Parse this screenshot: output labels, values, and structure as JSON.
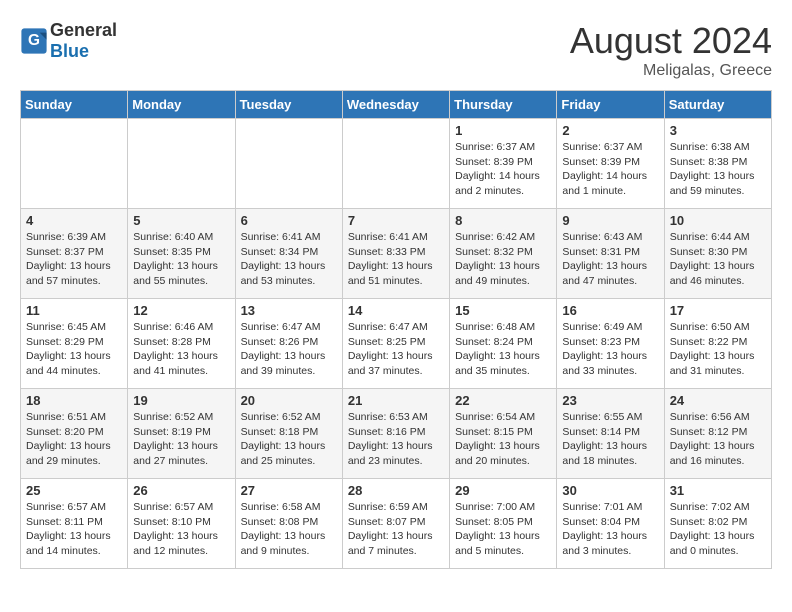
{
  "header": {
    "logo_general": "General",
    "logo_blue": "Blue",
    "month_year": "August 2024",
    "location": "Meligalas, Greece"
  },
  "days_of_week": [
    "Sunday",
    "Monday",
    "Tuesday",
    "Wednesday",
    "Thursday",
    "Friday",
    "Saturday"
  ],
  "weeks": [
    [
      {
        "day": "",
        "detail": ""
      },
      {
        "day": "",
        "detail": ""
      },
      {
        "day": "",
        "detail": ""
      },
      {
        "day": "",
        "detail": ""
      },
      {
        "day": "1",
        "detail": "Sunrise: 6:37 AM\nSunset: 8:39 PM\nDaylight: 14 hours\nand 2 minutes."
      },
      {
        "day": "2",
        "detail": "Sunrise: 6:37 AM\nSunset: 8:39 PM\nDaylight: 14 hours\nand 1 minute."
      },
      {
        "day": "3",
        "detail": "Sunrise: 6:38 AM\nSunset: 8:38 PM\nDaylight: 13 hours\nand 59 minutes."
      }
    ],
    [
      {
        "day": "4",
        "detail": "Sunrise: 6:39 AM\nSunset: 8:37 PM\nDaylight: 13 hours\nand 57 minutes."
      },
      {
        "day": "5",
        "detail": "Sunrise: 6:40 AM\nSunset: 8:35 PM\nDaylight: 13 hours\nand 55 minutes."
      },
      {
        "day": "6",
        "detail": "Sunrise: 6:41 AM\nSunset: 8:34 PM\nDaylight: 13 hours\nand 53 minutes."
      },
      {
        "day": "7",
        "detail": "Sunrise: 6:41 AM\nSunset: 8:33 PM\nDaylight: 13 hours\nand 51 minutes."
      },
      {
        "day": "8",
        "detail": "Sunrise: 6:42 AM\nSunset: 8:32 PM\nDaylight: 13 hours\nand 49 minutes."
      },
      {
        "day": "9",
        "detail": "Sunrise: 6:43 AM\nSunset: 8:31 PM\nDaylight: 13 hours\nand 47 minutes."
      },
      {
        "day": "10",
        "detail": "Sunrise: 6:44 AM\nSunset: 8:30 PM\nDaylight: 13 hours\nand 46 minutes."
      }
    ],
    [
      {
        "day": "11",
        "detail": "Sunrise: 6:45 AM\nSunset: 8:29 PM\nDaylight: 13 hours\nand 44 minutes."
      },
      {
        "day": "12",
        "detail": "Sunrise: 6:46 AM\nSunset: 8:28 PM\nDaylight: 13 hours\nand 41 minutes."
      },
      {
        "day": "13",
        "detail": "Sunrise: 6:47 AM\nSunset: 8:26 PM\nDaylight: 13 hours\nand 39 minutes."
      },
      {
        "day": "14",
        "detail": "Sunrise: 6:47 AM\nSunset: 8:25 PM\nDaylight: 13 hours\nand 37 minutes."
      },
      {
        "day": "15",
        "detail": "Sunrise: 6:48 AM\nSunset: 8:24 PM\nDaylight: 13 hours\nand 35 minutes."
      },
      {
        "day": "16",
        "detail": "Sunrise: 6:49 AM\nSunset: 8:23 PM\nDaylight: 13 hours\nand 33 minutes."
      },
      {
        "day": "17",
        "detail": "Sunrise: 6:50 AM\nSunset: 8:22 PM\nDaylight: 13 hours\nand 31 minutes."
      }
    ],
    [
      {
        "day": "18",
        "detail": "Sunrise: 6:51 AM\nSunset: 8:20 PM\nDaylight: 13 hours\nand 29 minutes."
      },
      {
        "day": "19",
        "detail": "Sunrise: 6:52 AM\nSunset: 8:19 PM\nDaylight: 13 hours\nand 27 minutes."
      },
      {
        "day": "20",
        "detail": "Sunrise: 6:52 AM\nSunset: 8:18 PM\nDaylight: 13 hours\nand 25 minutes."
      },
      {
        "day": "21",
        "detail": "Sunrise: 6:53 AM\nSunset: 8:16 PM\nDaylight: 13 hours\nand 23 minutes."
      },
      {
        "day": "22",
        "detail": "Sunrise: 6:54 AM\nSunset: 8:15 PM\nDaylight: 13 hours\nand 20 minutes."
      },
      {
        "day": "23",
        "detail": "Sunrise: 6:55 AM\nSunset: 8:14 PM\nDaylight: 13 hours\nand 18 minutes."
      },
      {
        "day": "24",
        "detail": "Sunrise: 6:56 AM\nSunset: 8:12 PM\nDaylight: 13 hours\nand 16 minutes."
      }
    ],
    [
      {
        "day": "25",
        "detail": "Sunrise: 6:57 AM\nSunset: 8:11 PM\nDaylight: 13 hours\nand 14 minutes."
      },
      {
        "day": "26",
        "detail": "Sunrise: 6:57 AM\nSunset: 8:10 PM\nDaylight: 13 hours\nand 12 minutes."
      },
      {
        "day": "27",
        "detail": "Sunrise: 6:58 AM\nSunset: 8:08 PM\nDaylight: 13 hours\nand 9 minutes."
      },
      {
        "day": "28",
        "detail": "Sunrise: 6:59 AM\nSunset: 8:07 PM\nDaylight: 13 hours\nand 7 minutes."
      },
      {
        "day": "29",
        "detail": "Sunrise: 7:00 AM\nSunset: 8:05 PM\nDaylight: 13 hours\nand 5 minutes."
      },
      {
        "day": "30",
        "detail": "Sunrise: 7:01 AM\nSunset: 8:04 PM\nDaylight: 13 hours\nand 3 minutes."
      },
      {
        "day": "31",
        "detail": "Sunrise: 7:02 AM\nSunset: 8:02 PM\nDaylight: 13 hours\nand 0 minutes."
      }
    ]
  ]
}
